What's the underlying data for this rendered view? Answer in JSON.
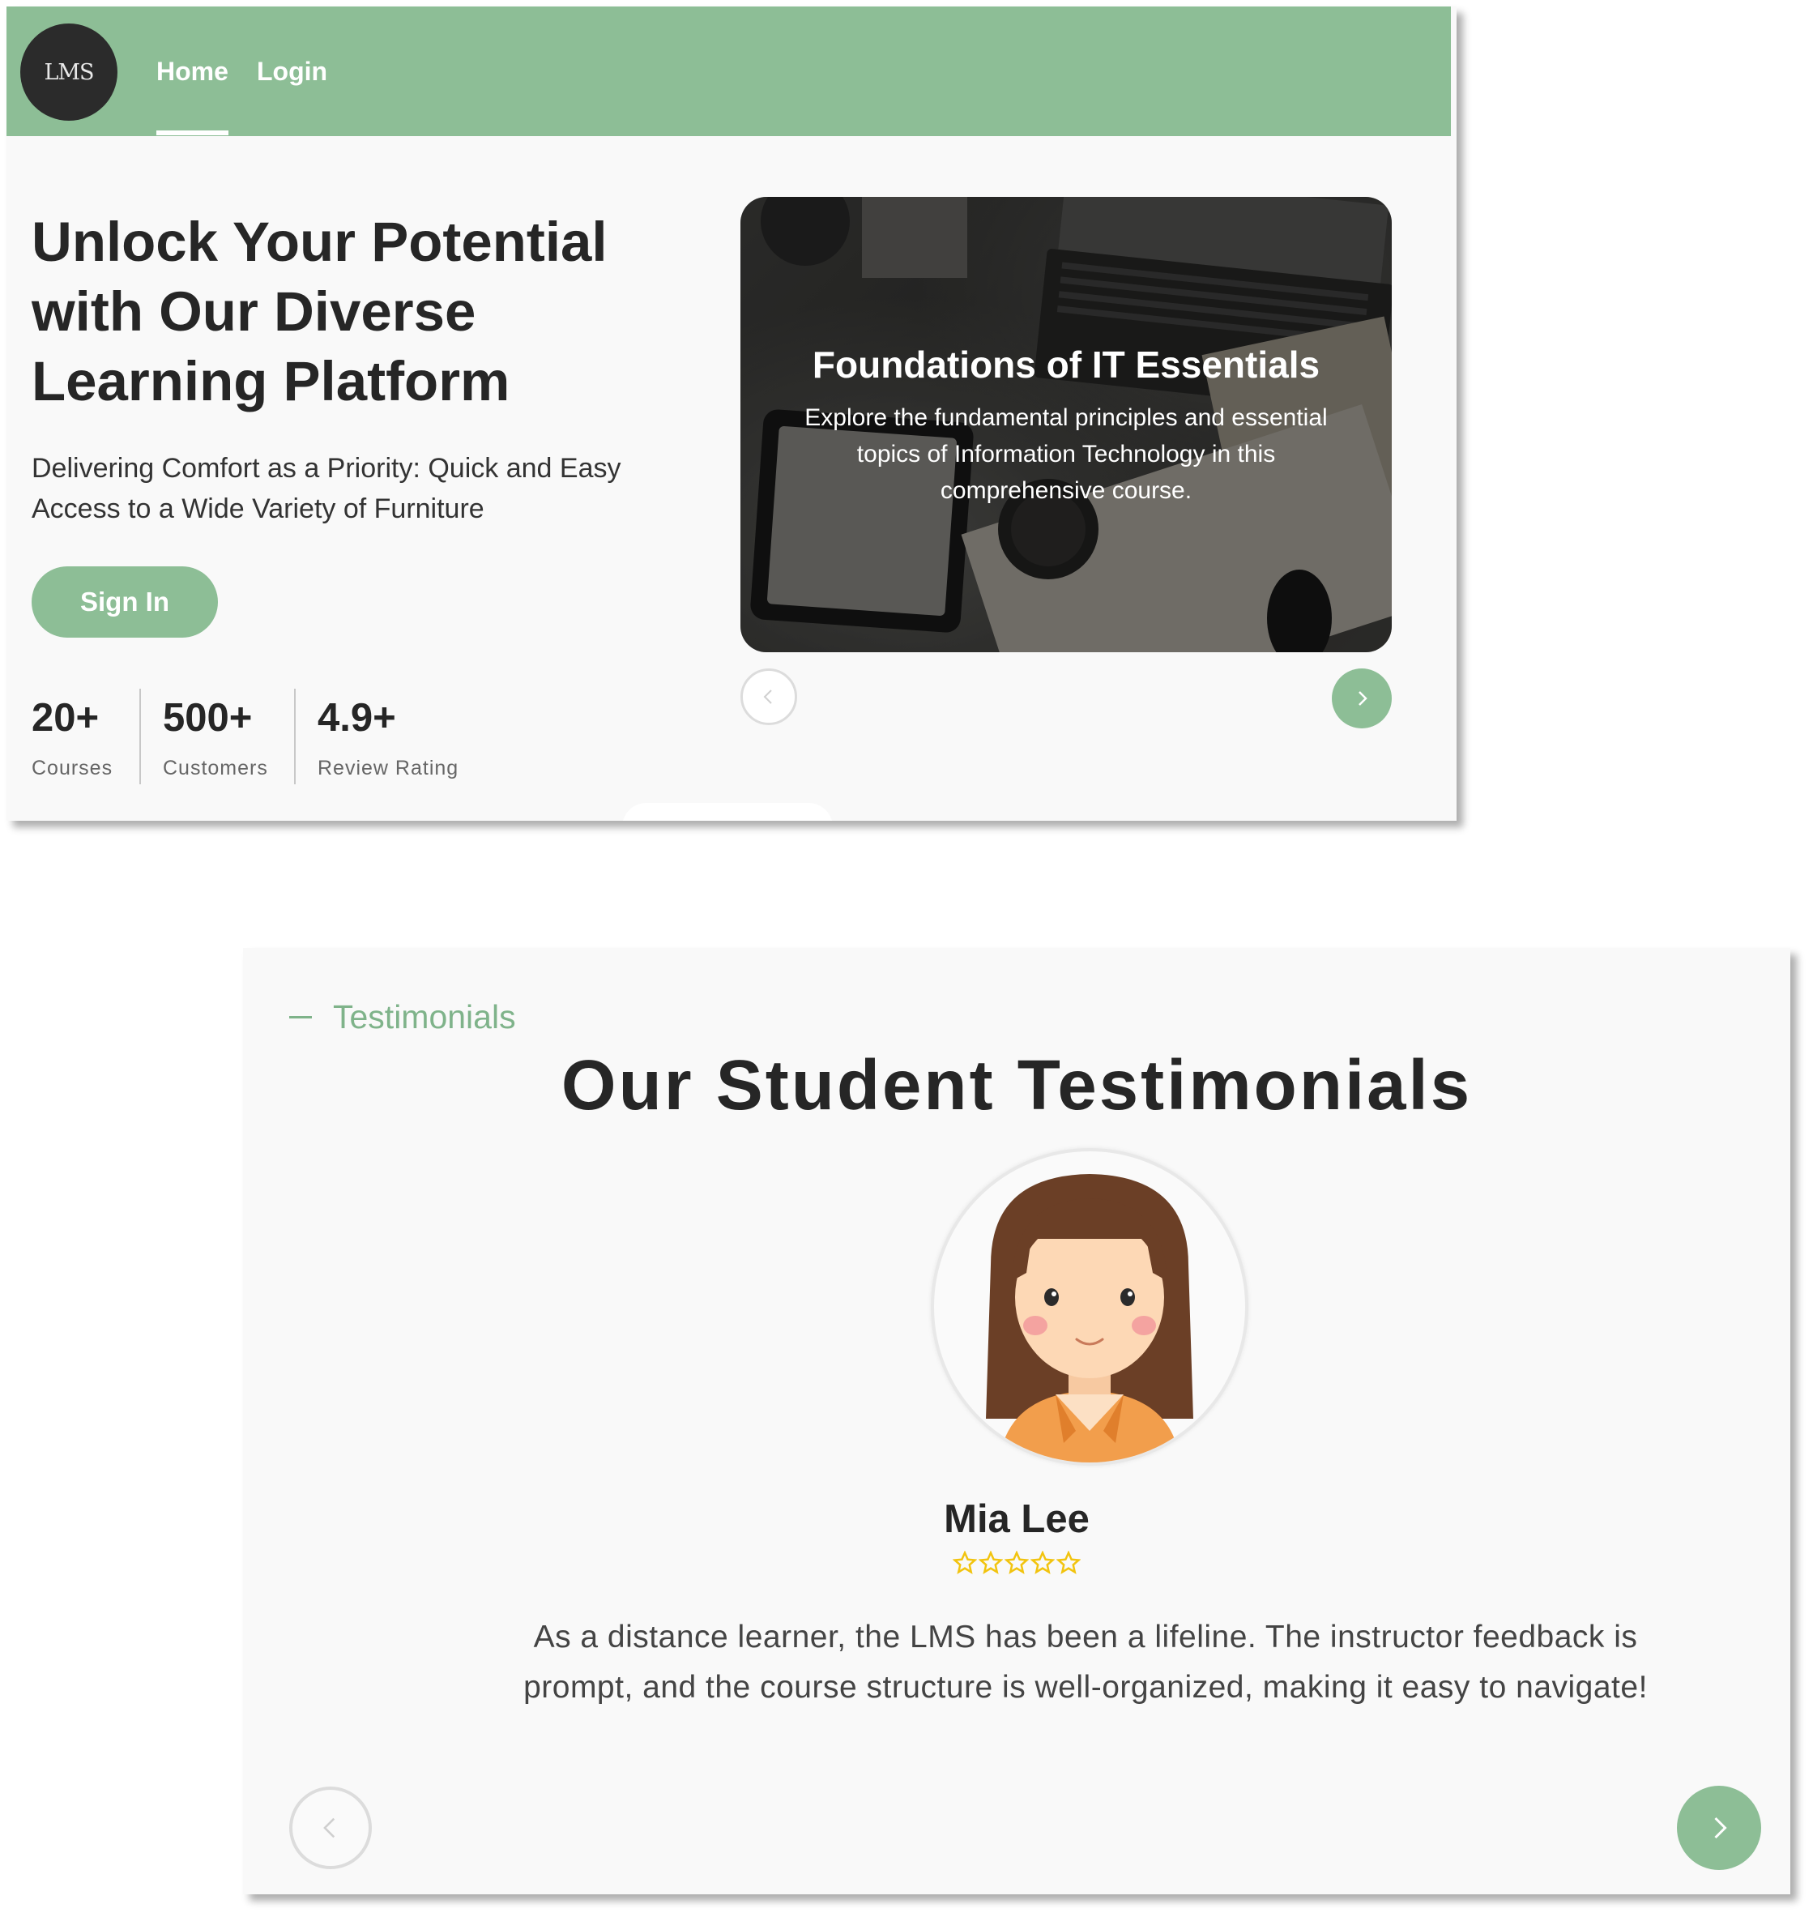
{
  "nav": {
    "logo_text": "LMS",
    "links": [
      {
        "label": "Home",
        "active": true
      },
      {
        "label": "Login",
        "active": false
      }
    ]
  },
  "hero": {
    "title": "Unlock Your Potential with Our Diverse Learning Platform",
    "subtitle": "Delivering Comfort as a Priority: Quick and Easy Access to a Wide Variety of Furniture",
    "cta_label": "Sign In",
    "stats": [
      {
        "value": "20+",
        "label": "Courses"
      },
      {
        "value": "500+",
        "label": "Customers"
      },
      {
        "value": "4.9+",
        "label": "Review Rating"
      }
    ]
  },
  "course_carousel": {
    "slide": {
      "title": "Foundations of IT Essentials",
      "description": "Explore the fundamental principles and essential topics of Information Technology in this comprehensive course."
    },
    "prev_icon": "chevron-left-icon",
    "next_icon": "chevron-right-icon"
  },
  "testimonials": {
    "eyebrow": "Testimonials",
    "title": "Our Student Testimonials",
    "student": {
      "name": "Mia Lee",
      "avatar_icon": "student-avatar",
      "rating": 5,
      "rating_max": 5,
      "quote": "As a distance learner, the LMS has been a lifeline. The instructor feedback is prompt, and the course structure is well-organized, making it easy to navigate!"
    }
  },
  "colors": {
    "brand_green": "#8dbe96",
    "dark": "#2b2b2b",
    "star": "#f2c40f"
  }
}
